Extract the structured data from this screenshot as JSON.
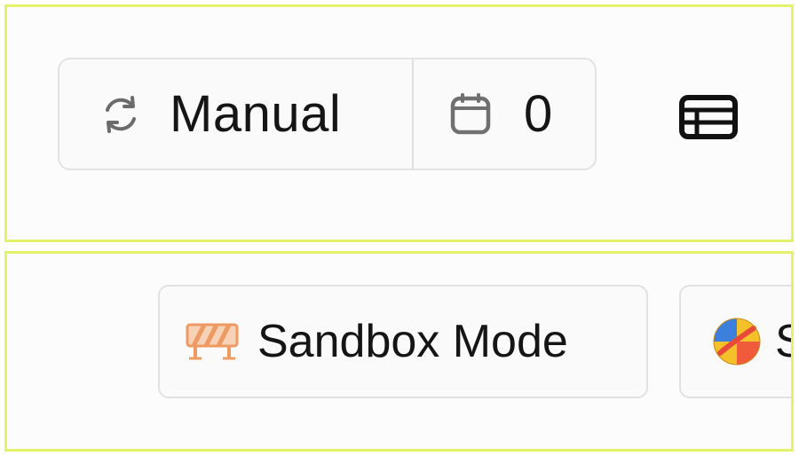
{
  "toolbar": {
    "sync_mode_label": "Manual",
    "sync_mode_icon": "refresh-icon",
    "date_count": "0",
    "date_icon": "calendar-icon",
    "table_view_icon": "table-icon"
  },
  "chips": {
    "sandbox": {
      "label": "Sandbox Mode",
      "icon": "barrier-icon"
    },
    "next": {
      "label": "S",
      "icon": "colored-ball-icon"
    }
  },
  "colors": {
    "highlight_border": "#e3f26a",
    "border": "#e2e2e2",
    "icon_gray": "#6b6b6b",
    "barrier_orange": "#f0a06a"
  }
}
